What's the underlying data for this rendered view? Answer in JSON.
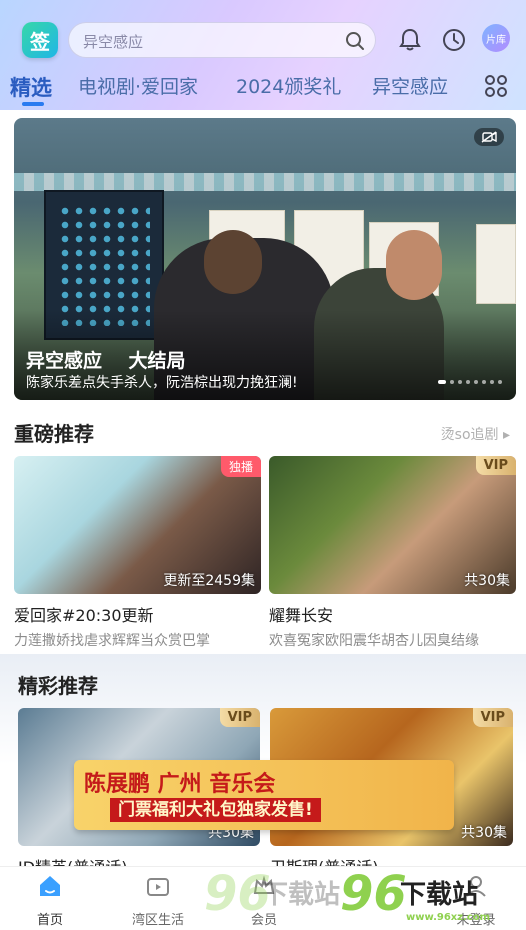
{
  "header": {
    "logo_text": "签",
    "search_placeholder": "异空感应",
    "avatar_text": "片库"
  },
  "tabs": [
    {
      "label": "精选"
    },
    {
      "label": "电视剧·爱回家"
    },
    {
      "label": "2024颁奖礼"
    },
    {
      "label": "异空感应"
    }
  ],
  "banner": {
    "title": "异空感应    大结局",
    "subtitle": "陈家乐差点失手杀人，阮浩棕出现力挽狂澜!",
    "dots": 8,
    "active_dot": 0
  },
  "section1": {
    "title": "重磅推荐",
    "more": "烫so追剧",
    "cards": [
      {
        "title": "爱回家#20:30更新",
        "desc": "力莲撒娇找虐求辉辉当众赏巴掌",
        "episode": "更新至2459集",
        "badge": "独播"
      },
      {
        "title": "耀舞长安",
        "desc": "欢喜冤家欧阳震华胡杏儿因臭结缘",
        "episode": "共30集",
        "badge": "VIP"
      }
    ]
  },
  "section2": {
    "title": "精彩推荐",
    "cards": [
      {
        "title": "ID精英(普通话)",
        "episode": "共30集",
        "badge": "VIP"
      },
      {
        "title": "卫斯理(普通话)",
        "episode": "共30集",
        "badge": "VIP"
      }
    ]
  },
  "ad": {
    "line1": "陈展鹏 广州 音乐会",
    "line2": "门票福利大礼包独家发售!"
  },
  "bottom_nav": [
    {
      "label": "首页"
    },
    {
      "label": "湾区生活"
    },
    {
      "label": "会员"
    },
    {
      "label": "未登录"
    }
  ],
  "watermark": {
    "brand": "96",
    "text": "下载站",
    "url": "www.96xz.com"
  },
  "colors": {
    "accent": "#2a7bf0",
    "badge_red": "#ff5a6b",
    "vip_gold": "#d9b26e"
  }
}
